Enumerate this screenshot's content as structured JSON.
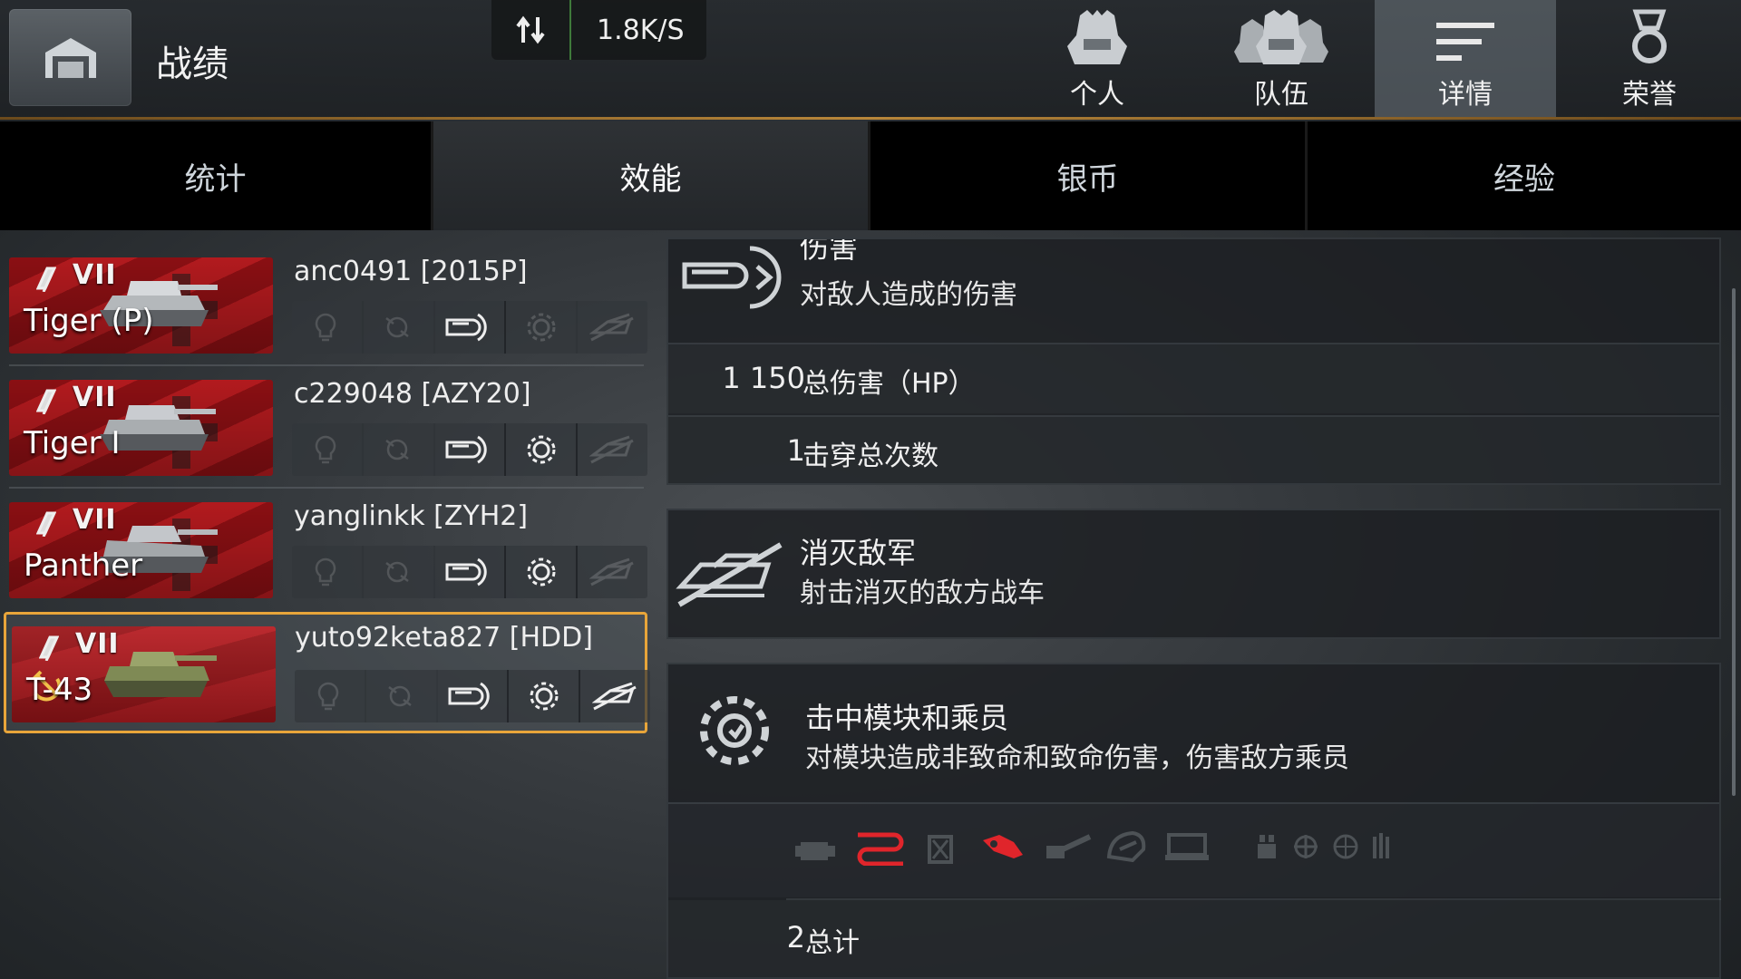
{
  "header": {
    "title": "战绩",
    "net_speed": "1.8K/S",
    "nav": [
      {
        "label": "个人",
        "icon": "personal-helmet-icon"
      },
      {
        "label": "队伍",
        "icon": "team-helmets-icon"
      },
      {
        "label": "详情",
        "icon": "details-lines-icon",
        "active": true
      },
      {
        "label": "荣誉",
        "icon": "medal-icon"
      }
    ]
  },
  "tabs": [
    {
      "label": "统计"
    },
    {
      "label": "效能",
      "active": true
    },
    {
      "label": "银币"
    },
    {
      "label": "经验"
    }
  ],
  "vehicles": [
    {
      "tier": "VII",
      "name": "Tiger (P)",
      "player": "anc0491 [2015P]",
      "nation": "germany",
      "badges": {
        "spotted": false,
        "assist": false,
        "damage": true,
        "modules": false,
        "kill": false
      }
    },
    {
      "tier": "VII",
      "name": "Tiger I",
      "player": "c229048 [AZY20]",
      "nation": "germany",
      "badges": {
        "spotted": false,
        "assist": false,
        "damage": true,
        "modules": true,
        "kill": false
      }
    },
    {
      "tier": "VII",
      "name": "Panther",
      "player": "yanglinkk [ZYH2]",
      "nation": "germany",
      "badges": {
        "spotted": false,
        "assist": false,
        "damage": true,
        "modules": true,
        "kill": false
      }
    },
    {
      "tier": "VII",
      "name": "T-43",
      "player": "yuto92keta827 [HDD]",
      "nation": "ussr",
      "selected": true,
      "badges": {
        "spotted": false,
        "assist": false,
        "damage": true,
        "modules": true,
        "kill": true
      }
    }
  ],
  "damage_panel": {
    "title": "伤害",
    "subtitle": "对敌人造成的伤害",
    "rows": [
      {
        "value": "1 150",
        "label": "总伤害（HP）"
      },
      {
        "value": "1",
        "label": "击穿总次数"
      }
    ]
  },
  "kill_panel": {
    "title": "消灭敌军",
    "subtitle": "射击消灭的敌方战车"
  },
  "modules_panel": {
    "title": "击中模块和乘员",
    "subtitle": "对模块造成非致命和致命伤害，伤害敌方乘员",
    "module_icons": [
      {
        "name": "engine-icon",
        "hit": false
      },
      {
        "name": "track-icon",
        "hit": true
      },
      {
        "name": "fuel-tank-icon",
        "hit": false
      },
      {
        "name": "ammo-rack-icon",
        "hit": true
      },
      {
        "name": "gun-icon",
        "hit": false
      },
      {
        "name": "turret-icon",
        "hit": false
      },
      {
        "name": "observation-device-icon",
        "hit": false
      },
      {
        "name": "crew-icon",
        "hit": false
      },
      {
        "name": "gunner-icon",
        "hit": false
      },
      {
        "name": "radio-icon",
        "hit": false
      },
      {
        "name": "loader-icon",
        "hit": false
      }
    ],
    "total_value": "2",
    "total_label": "总计"
  },
  "colors": {
    "accent": "#e8a53a",
    "hit": "#e0252b",
    "divider": "#b8863a"
  }
}
